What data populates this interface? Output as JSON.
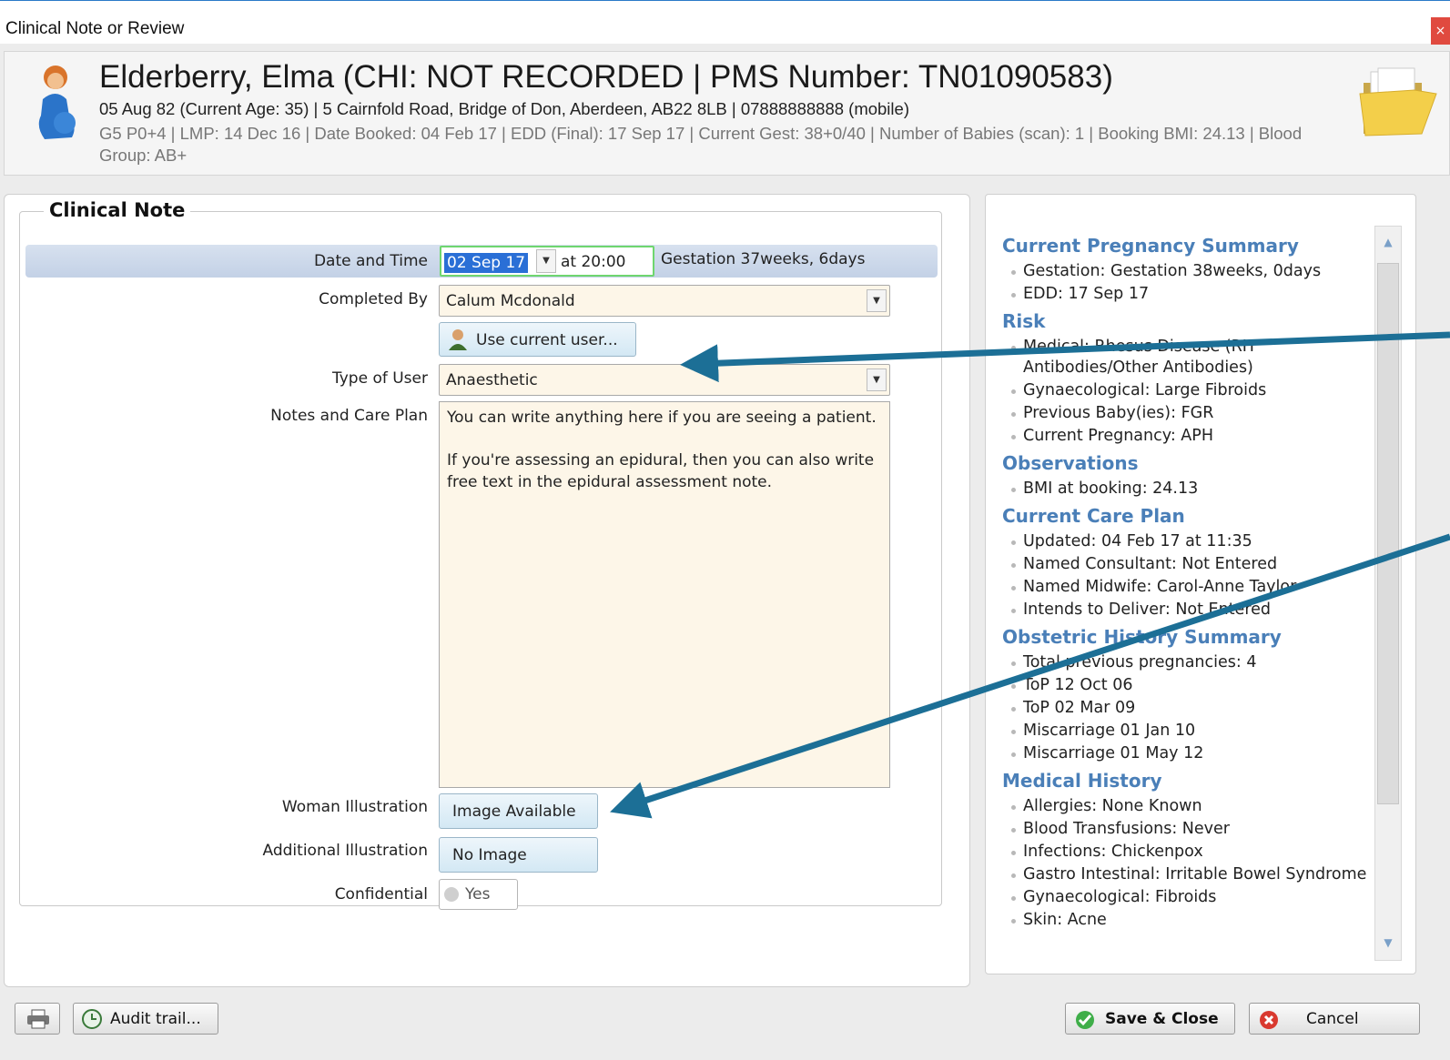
{
  "window": {
    "title": "Clinical Note or Review",
    "close_glyph": "×"
  },
  "patient": {
    "name": "Elderberry, Elma (CHI: NOT RECORDED | PMS Number: TN01090583)",
    "line1": "05 Aug 82 (Current Age: 35) | 5 Cairnfold Road, Bridge of Don, Aberdeen, AB22 8LB | 07888888888 (mobile)",
    "line2": "G5 P0+4  | LMP: 14 Dec 16 | Date Booked: 04 Feb 17 | EDD (Final): 17 Sep 17 | Current Gest: 38+0/40 | Number of Babies (scan): 1 | Booking BMI: 24.13 | Blood Group: AB+"
  },
  "form": {
    "legend": "Clinical Note",
    "date_label": "Date and Time",
    "date_value": "02 Sep 17",
    "time_value": "at 20:00",
    "gestation": "Gestation 37weeks, 6days",
    "completed_by_label": "Completed By",
    "completed_by_value": "Calum Mcdonald",
    "use_current_user": "Use current user...",
    "type_of_user_label": "Type of User",
    "type_of_user_value": "Anaesthetic",
    "notes_label": "Notes and Care Plan",
    "notes_value": "You can write anything here if you are seeing a patient.\n\nIf you're assessing an epidural, then you can also write free text in the epidural assessment note.",
    "woman_illustration_label": "Woman Illustration",
    "woman_illustration_button": "Image Available",
    "additional_illustration_label": "Additional Illustration",
    "additional_illustration_button": "No Image",
    "confidential_label": "Confidential",
    "confidential_value": "Yes"
  },
  "summary": {
    "sections": [
      {
        "title": "Current Pregnancy Summary",
        "items": [
          "Gestation: Gestation 38weeks, 0days",
          "EDD: 17 Sep 17"
        ]
      },
      {
        "title": "Risk",
        "items": [
          "Medical: Rhesus Disease (RH Antibodies/Other Antibodies)",
          "Gynaecological: Large Fibroids",
          "Previous Baby(ies): FGR",
          "Current Pregnancy: APH"
        ]
      },
      {
        "title": "Observations",
        "items": [
          "BMI at booking: 24.13"
        ]
      },
      {
        "title": "Current Care Plan",
        "items": [
          "Updated: 04 Feb 17 at 11:35",
          "Named Consultant: Not Entered",
          "Named Midwife: Carol-Anne Taylor",
          "Intends to Deliver: Not Entered"
        ]
      },
      {
        "title": "Obstetric History Summary",
        "items": [
          "Total previous pregnancies: 4",
          "ToP 12 Oct 06",
          "ToP 02 Mar 09",
          "Miscarriage 01 Jan 10",
          "Miscarriage 01 May 12"
        ]
      },
      {
        "title": "Medical History",
        "items": [
          "Allergies: None Known",
          "Blood Transfusions: Never",
          "Infections: Chickenpox",
          "Gastro Intestinal: Irritable Bowel Syndrome",
          "Gynaecological: Fibroids",
          "Skin: Acne"
        ]
      }
    ]
  },
  "footer": {
    "audit_trail": "Audit trail...",
    "save_close": "Save & Close",
    "cancel": "Cancel"
  },
  "icons": {
    "patient": "pregnant-woman-icon",
    "folder": "folder-icon",
    "user": "user-icon",
    "print": "printer-icon",
    "audit": "audit-icon",
    "save": "checkmark-icon",
    "cancel": "cancel-icon"
  },
  "colors": {
    "accent": "#4a7fb8",
    "annotation_arrow": "#1c6f96",
    "focus_border": "#6fd66f"
  }
}
